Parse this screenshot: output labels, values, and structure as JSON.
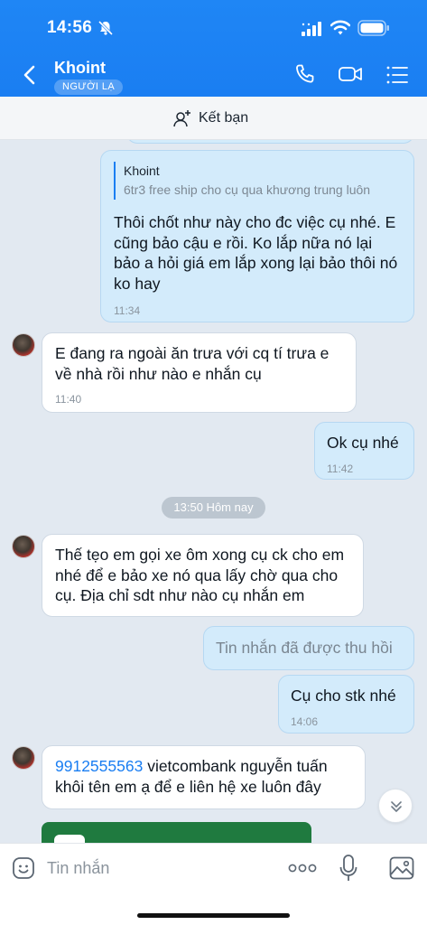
{
  "status_bar": {
    "time": "14:56"
  },
  "header": {
    "contact_name": "Khoint",
    "badge": "NGƯỜI LẠ",
    "icons": [
      "back-icon",
      "call-icon",
      "video-call-icon",
      "menu-icon"
    ]
  },
  "add_friend": {
    "label": "Kết bạn"
  },
  "messages": {
    "m1": {
      "quote_name": "Khoint",
      "quote_text": "6tr3 free ship cho cụ qua khương trung luôn",
      "text": "Thôi chốt như này cho đc việc cụ nhé. E cũng bảo cậu e rồi. Ko lắp nữa nó lại bảo a hỏi giá em lắp xong lại bảo thôi nó ko hay",
      "time": "11:34"
    },
    "m2": {
      "text": "E đang ra ngoài ăn trưa với cq tí trưa e về nhà rồi như nào e nhắn cụ",
      "time": "11:40"
    },
    "m3": {
      "text": "Ok cụ nhé",
      "time": "11:42"
    },
    "date_chip": "13:50 Hôm nay",
    "m4": {
      "text": "Thế tẹo em gọi xe ôm xong cụ ck cho em nhé để e bảo xe nó qua lấy chờ qua cho cụ. Địa chỉ sdt như nào cụ nhắn em"
    },
    "m5": {
      "text": "Tin nhắn đã được thu hồi"
    },
    "m6": {
      "text": "Cụ cho stk nhé",
      "time": "14:06"
    },
    "m7": {
      "link": "9912555563",
      "text": " vietcombank nguyễn tuấn khôi tên em ạ để e liên hệ xe luôn đây"
    }
  },
  "input": {
    "placeholder": "Tin nhắn"
  },
  "colors": {
    "header": "#1a7ef2",
    "outgoing": "#d3ebfb",
    "incoming": "#ffffff",
    "background": "#e2e9f1"
  }
}
